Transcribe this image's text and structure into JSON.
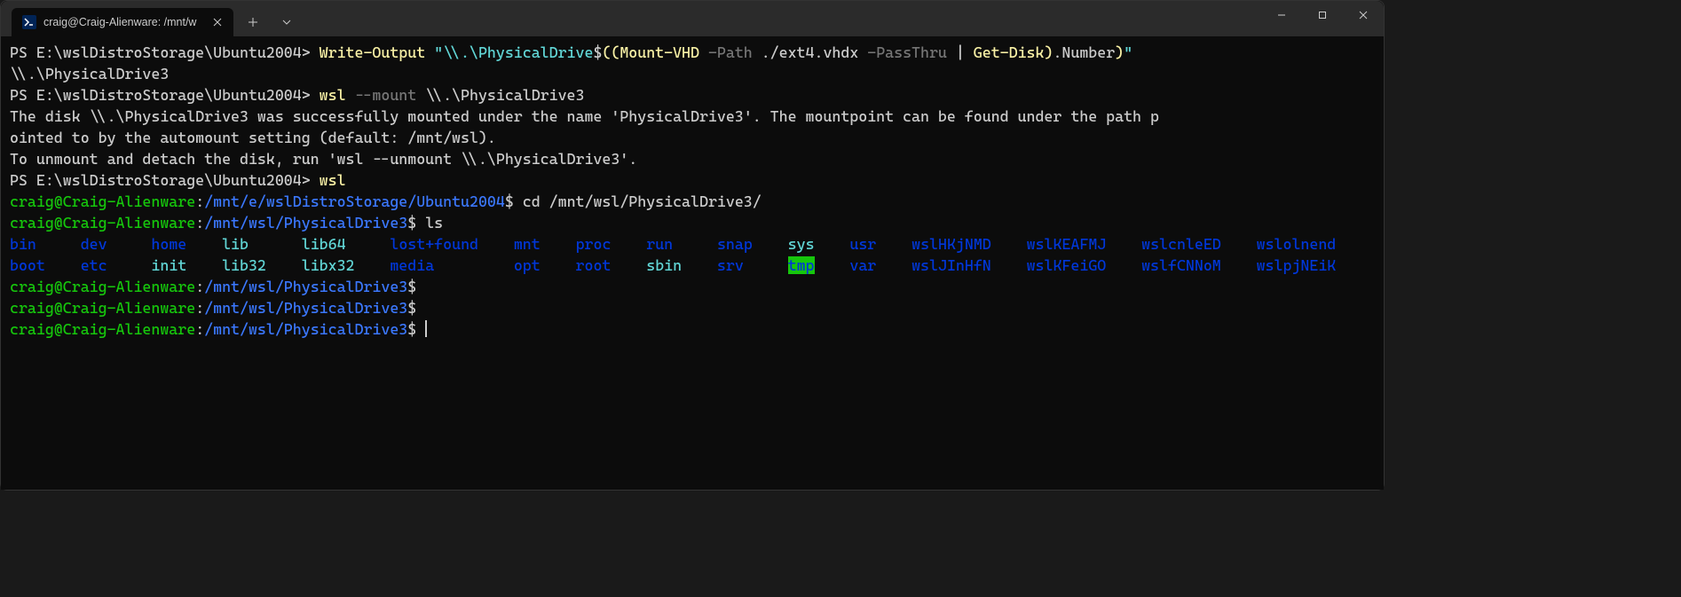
{
  "tab": {
    "title": "craig@Craig-Alienware: /mnt/w"
  },
  "ps_prompt": "PS E:\\wslDistroStorage\\Ubuntu2004> ",
  "line1": {
    "cmd": "Write-Output",
    "str_open": " \"\\\\.\\PhysicalDrive",
    "dollar": "$",
    "p1": "((",
    "mount": "Mount-VHD",
    "path_flag": " -Path",
    "path_arg": " ./ext4.vhdx",
    "passthru": " -PassThru",
    "pipe": " | ",
    "getdisk": "Get-Disk",
    "p2": ")",
    "number": ".Number",
    "p3": ")",
    "str_close": "\""
  },
  "line2": "\\\\.\\PhysicalDrive3",
  "line3": {
    "cmd": "wsl",
    "flag": " --mount",
    "arg": " \\\\.\\PhysicalDrive3"
  },
  "line4": "The disk \\\\.\\PhysicalDrive3 was successfully mounted under the name 'PhysicalDrive3'. The mountpoint can be found under the path p",
  "line5": "ointed to by the automount setting (default: /mnt/wsl).",
  "line6": "To unmount and detach the disk, run 'wsl --unmount \\\\.\\PhysicalDrive3'.",
  "line7": {
    "cmd": "wsl"
  },
  "bash": {
    "user": "craig@Craig-Alienware",
    "colon": ":",
    "path1": "/mnt/e/wslDistroStorage/Ubuntu2004",
    "path2": "/mnt/wsl/PhysicalDrive3",
    "dollar": "$",
    "cmd_cd": " cd /mnt/wsl/PhysicalDrive3/",
    "cmd_ls": " ls"
  },
  "ls_row1": {
    "c0": "bin",
    "c1": "dev",
    "c2": "home",
    "c3": "lib",
    "c4": "lib64",
    "c5": "lost+found",
    "c6": "mnt",
    "c7": "proc",
    "c8": "run",
    "c9": "snap",
    "c10": "sys",
    "c11": "usr",
    "c12": "wslHKjNMD",
    "c13": "wslKEAFMJ",
    "c14": "wslcnleED",
    "c15": "wslolnend"
  },
  "ls_row2": {
    "c0": "boot",
    "c1": "etc",
    "c2": "init",
    "c3": "lib32",
    "c4": "libx32",
    "c5": "media",
    "c6": "opt",
    "c7": "root",
    "c8": "sbin",
    "c9": "srv",
    "c10": "tmp",
    "c11": "var",
    "c12": "wslJInHfN",
    "c13": "wslKFeiGO",
    "c14": "wslfCNNoM",
    "c15": "wslpjNEiK"
  }
}
